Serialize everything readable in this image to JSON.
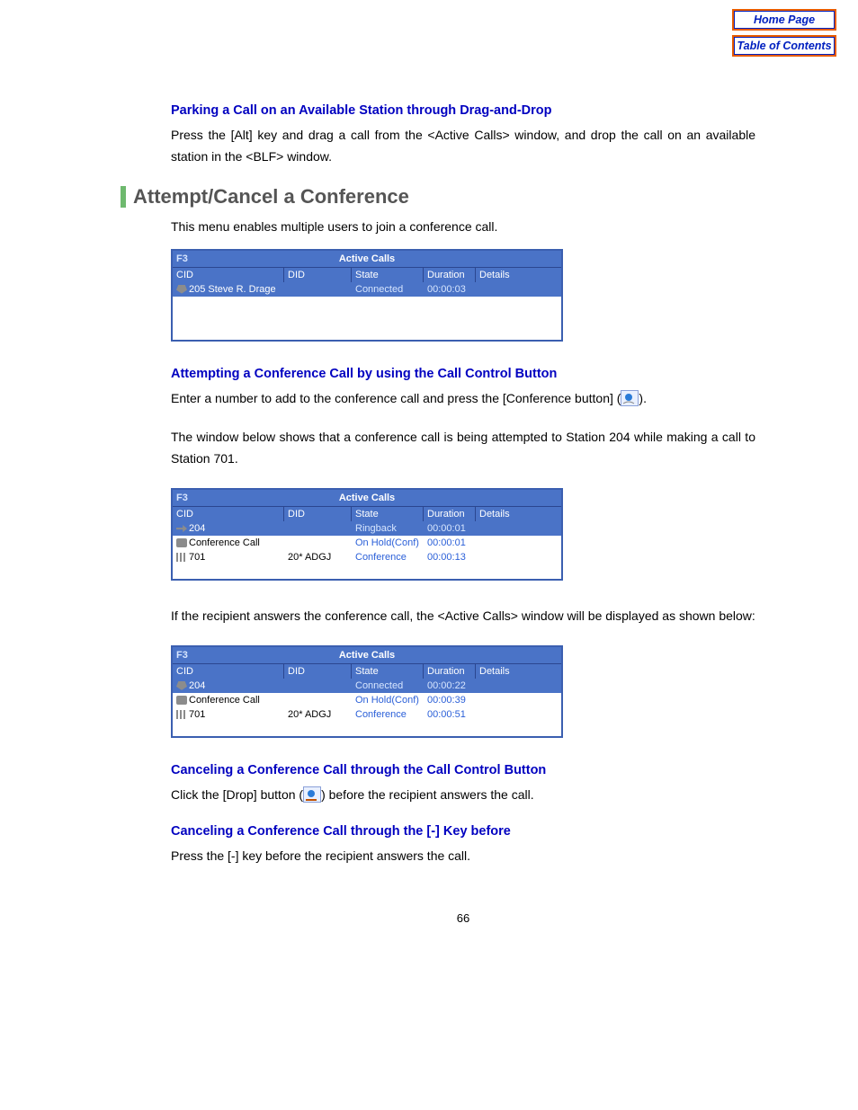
{
  "nav": {
    "home": "Home Page",
    "toc": "Table of Contents"
  },
  "sec1": {
    "title": "Parking a Call on an Available Station through Drag-and-Drop",
    "body": "Press the [Alt] key and drag a call from the <Active Calls> window, and drop the call on an available station in the <BLF> window."
  },
  "major": "Attempt/Cancel a Conference",
  "intro": "This menu enables multiple users to join a conference call.",
  "ac": {
    "key": "F3",
    "title": "Active Calls",
    "cols": {
      "cid": "CID",
      "did": "DID",
      "state": "State",
      "duration": "Duration",
      "details": "Details"
    }
  },
  "table1": {
    "rows": [
      {
        "cid": "205 Steve R. Drage",
        "did": "",
        "state": "Connected",
        "duration": "00:00:03",
        "details": "",
        "sel": true,
        "icon": "phone"
      }
    ],
    "blanks": 3
  },
  "sec2": {
    "title": "Attempting a Conference Call by using the Call Control Button",
    "body_a": "Enter a number to add to the conference call and press the [Conference button] (",
    "body_b": ").",
    "body2": "The window below shows that a conference call is being attempted to Station 204 while making a call to Station 701."
  },
  "table2": {
    "rows": [
      {
        "cid": "204",
        "did": "",
        "state": "Ringback",
        "duration": "00:00:01",
        "details": "",
        "sel": true,
        "icon": "out"
      },
      {
        "cid": "Conference Call",
        "did": "",
        "state": "On Hold(Conf)",
        "duration": "00:00:01",
        "details": "",
        "sel": false,
        "icon": "conf"
      },
      {
        "cid": "701",
        "did": "20* ADGJ",
        "state": "Conference",
        "duration": "00:00:13",
        "details": "",
        "sel": false,
        "icon": "hold"
      }
    ],
    "blanks": 1
  },
  "sec3": "If the recipient answers the conference call, the <Active Calls> window will be displayed as shown below:",
  "table3": {
    "rows": [
      {
        "cid": "204",
        "did": "",
        "state": "Connected",
        "duration": "00:00:22",
        "details": "",
        "sel": true,
        "icon": "phone"
      },
      {
        "cid": "Conference Call",
        "did": "",
        "state": "On Hold(Conf)",
        "duration": "00:00:39",
        "details": "",
        "sel": false,
        "icon": "conf"
      },
      {
        "cid": "701",
        "did": "20* ADGJ",
        "state": "Conference",
        "duration": "00:00:51",
        "details": "",
        "sel": false,
        "icon": "hold"
      }
    ],
    "blanks": 1
  },
  "sec4": {
    "title": "Canceling a Conference Call through the Call Control Button",
    "body_a": "Click the [Drop] button (",
    "body_b": ") before the recipient answers the call."
  },
  "sec5": {
    "title": "Canceling a Conference Call through the [-] Key before",
    "body": "Press the [-] key before the recipient answers the call."
  },
  "page_num": "66"
}
